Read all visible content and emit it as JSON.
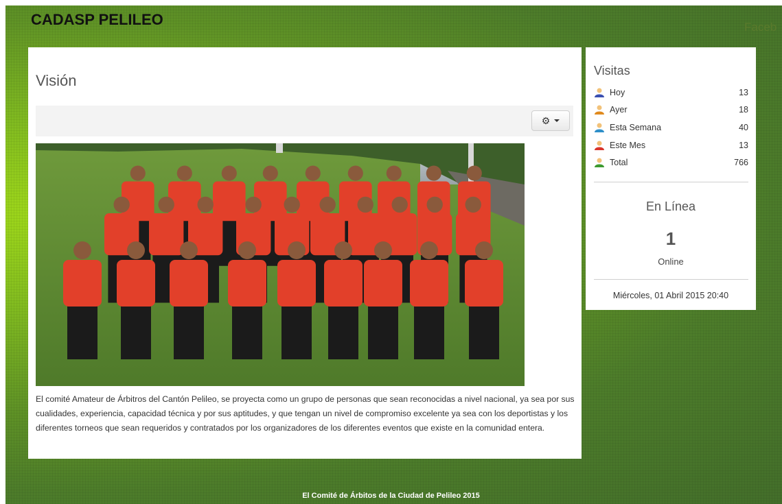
{
  "header": {
    "site_title": "CADASP PELILEO",
    "social_link": "Faceb"
  },
  "main": {
    "title": "Visión",
    "settings_icon": "gear-icon",
    "photo_description": "",
    "paragraph": "El comité Amateur de Árbitros del Cantón Pelileo, se proyecta como un grupo de personas que sean reconocidas a nivel nacional, ya sea por sus cualidades, experiencia, capacidad técnica y por sus aptitudes, y que tengan un nivel de compromiso excelente ya sea con los deportistas y los diferentes torneos que sean requeridos y contratados por los organizadores de los diferentes eventos que existe en la comunidad entera."
  },
  "sidebar": {
    "visits_title": "Visitas",
    "stats": [
      {
        "label": "Hoy",
        "value": "13",
        "icon": "user-icon",
        "color": "#3a4fb0"
      },
      {
        "label": "Ayer",
        "value": "18",
        "icon": "user-icon",
        "color": "#e08a1e"
      },
      {
        "label": "Esta Semana",
        "value": "40",
        "icon": "user-icon",
        "color": "#2e8fc9"
      },
      {
        "label": "Este Mes",
        "value": "13",
        "icon": "user-icon",
        "color": "#d9342b"
      },
      {
        "label": "Total",
        "value": "766",
        "icon": "user-icon",
        "color": "#3d9a2f"
      }
    ],
    "online_title": "En Línea",
    "online_count": "1",
    "online_label": "Online",
    "datetime": "Miércoles, 01 Abril 2015 20:40"
  },
  "footer": {
    "text": "El Comité de Árbitos de la Ciudad de Pelileo 2015"
  }
}
